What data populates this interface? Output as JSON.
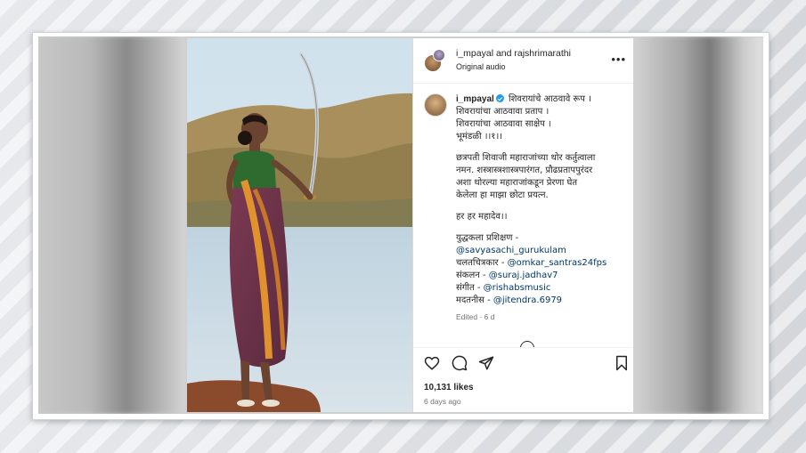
{
  "post": {
    "header": {
      "names": "i_mpayal and rajshrimarathi",
      "subtitle": "Original audio",
      "more_icon": "more-horizontal-icon"
    },
    "caption": {
      "username": "i_mpayal",
      "verified": true,
      "lines_poem": [
        "शिवरायांचे आठवावे रूप ।",
        "शिवरायांचा आठवावा प्रताप ।",
        "शिवरायांचा आठवावा साक्षेप ।",
        "भूमंडळी ।।१।।"
      ],
      "lines_para": [
        "छत्रपती शिवाजी महाराजांच्या थोर कर्तुत्वाला",
        "नमन. शस्त्रास्त्रशास्त्रपारंगत, प्रौढप्रतापपुरंदर",
        "अशा थोरल्या महाराजांकडून प्रेरणा घेत",
        "केलेला हा माझा छोटा प्रयत्न."
      ],
      "har_har": "हर हर महादेव।।",
      "credits": [
        {
          "label": "युद्धकला प्रशिक्षण - ",
          "mention": ""
        },
        {
          "label": "",
          "mention": "@savyasachi_gurukulam"
        },
        {
          "label": "चलतचित्रकार - ",
          "mention": "@omkar_santras24fps"
        },
        {
          "label": "संकलन - ",
          "mention": "@suraj.jadhav7"
        },
        {
          "label": "संगीत - ",
          "mention": "@rishabsmusic"
        },
        {
          "label": "मदतनीस - ",
          "mention": "@jitendra.6979"
        }
      ],
      "edited": "Edited · 6 d"
    },
    "actions": {
      "like_icon": "heart-icon",
      "comment_icon": "comment-icon",
      "share_icon": "send-icon",
      "save_icon": "bookmark-icon"
    },
    "likes": "10,131 likes",
    "time_ago": "6 days ago"
  },
  "colors": {
    "mention": "#00376b",
    "verified": "#1d9bf0",
    "text": "#262626",
    "muted": "#737373"
  }
}
